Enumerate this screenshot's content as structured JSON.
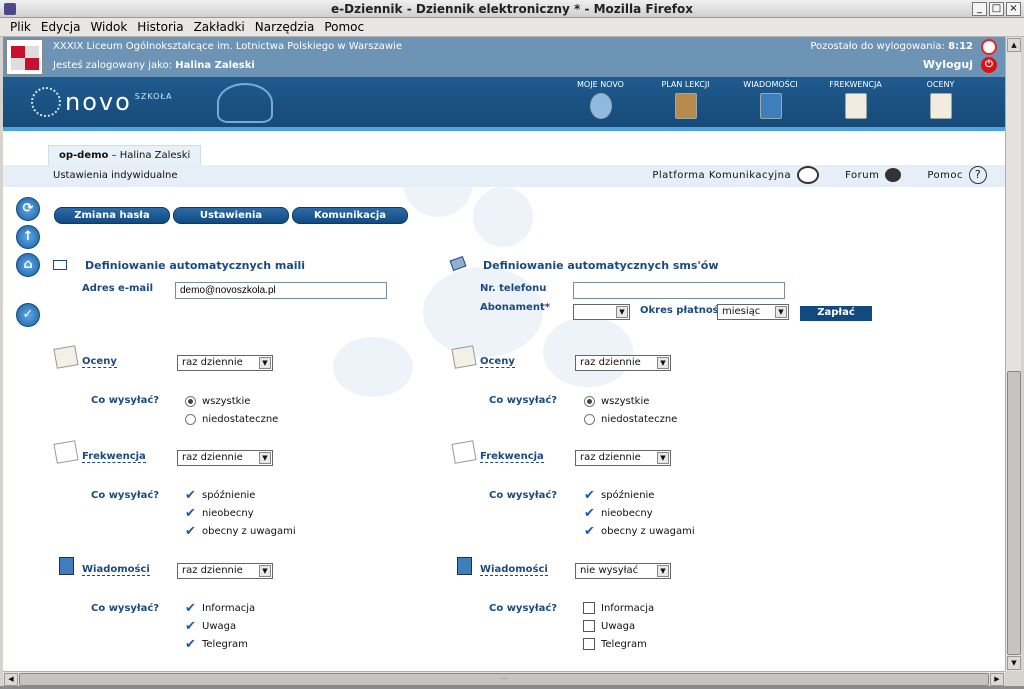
{
  "window": {
    "title": "e-Dziennik - Dziennik elektroniczny * - Mozilla Firefox",
    "buttons": [
      "_",
      "□",
      "×"
    ]
  },
  "menu": [
    "Plik",
    "Edycja",
    "Widok",
    "Historia",
    "Zakładki",
    "Narzędzia",
    "Pomoc"
  ],
  "header": {
    "school": "XXXIX Liceum Ogólnokształcące im. Lotnictwa Polskiego w Warszawie",
    "logged_prefix": "Jesteś zalogowany jako:",
    "logged_user": "Halina Zaleski",
    "timer_prefix": "Pozostało do wylogowania:",
    "timer_value": "8:12",
    "logout": "Wyloguj"
  },
  "banner": {
    "logo": "novo",
    "logo_sub": "SZKOŁA",
    "nav": [
      "MOJE NOVO",
      "PLAN LEKCJI",
      "WIADOMOŚCI",
      "FREKWENCJA",
      "OCENY"
    ]
  },
  "usertab": {
    "code": "op-demo",
    "sep": " – ",
    "name": "Halina Zaleski"
  },
  "subbar": {
    "path": "Ustawienia indywidualne",
    "platform": "Platforma Komunikacyjna",
    "forum": "Forum",
    "help": "Pomoc"
  },
  "tabs": [
    "Zmiana hasła",
    "Ustawienia",
    "Komunikacja"
  ],
  "mail": {
    "heading": "Definiowanie automatycznych maili",
    "email_label": "Adres e-mail",
    "email_value": "demo@novoszkola.pl",
    "categories": [
      {
        "label": "Oceny",
        "frequency": "raz dziennie",
        "what_label": "Co wysyłać?",
        "type": "radio",
        "options": [
          {
            "label": "wszystkie",
            "checked": true
          },
          {
            "label": "niedostateczne",
            "checked": false
          }
        ]
      },
      {
        "label": "Frekwencja",
        "frequency": "raz dziennie",
        "what_label": "Co wysyłać?",
        "type": "check",
        "options": [
          {
            "label": "spóźnienie",
            "checked": true
          },
          {
            "label": "nieobecny",
            "checked": true
          },
          {
            "label": "obecny z uwagami",
            "checked": true
          }
        ]
      },
      {
        "label": "Wiadomości",
        "frequency": "raz dziennie",
        "what_label": "Co wysyłać?",
        "type": "check",
        "options": [
          {
            "label": "Informacja",
            "checked": true
          },
          {
            "label": "Uwaga",
            "checked": true
          },
          {
            "label": "Telegram",
            "checked": true
          }
        ]
      }
    ]
  },
  "sms": {
    "heading": "Definiowanie automatycznych sms'ów",
    "phone_label": "Nr. telefonu",
    "phone_value": "",
    "subscription_label": "Abonament*",
    "subscription_value": "",
    "period_label": "Okres płatności",
    "period_value": "miesiąc",
    "pay_button": "Zapłać",
    "categories": [
      {
        "label": "Oceny",
        "frequency": "raz dziennie",
        "what_label": "Co wysyłać?",
        "type": "radio",
        "options": [
          {
            "label": "wszystkie",
            "checked": true
          },
          {
            "label": "niedostateczne",
            "checked": false
          }
        ]
      },
      {
        "label": "Frekwencja",
        "frequency": "raz dziennie",
        "what_label": "Co wysyłać?",
        "type": "check",
        "options": [
          {
            "label": "spóźnienie",
            "checked": true
          },
          {
            "label": "nieobecny",
            "checked": true
          },
          {
            "label": "obecny z uwagami",
            "checked": true
          }
        ]
      },
      {
        "label": "Wiadomości",
        "frequency": "nie wysyłać",
        "what_label": "Co wysyłać?",
        "type": "box",
        "options": [
          {
            "label": "Informacja",
            "checked": false
          },
          {
            "label": "Uwaga",
            "checked": false
          },
          {
            "label": "Telegram",
            "checked": false
          }
        ]
      }
    ]
  },
  "icons": {
    "left": [
      "refresh-icon",
      "arrow-up-icon",
      "home-icon",
      "check-circle-icon"
    ],
    "left_glyphs": [
      "⟳",
      "↑",
      "⌂",
      "✓"
    ],
    "check_glyph": "✔",
    "help_glyph": "?",
    "dropdown_glyph": "▼"
  },
  "colors": {
    "accent": "#1f5b8e",
    "banner_top": "#6d93b5",
    "label": "#1a4a80"
  }
}
